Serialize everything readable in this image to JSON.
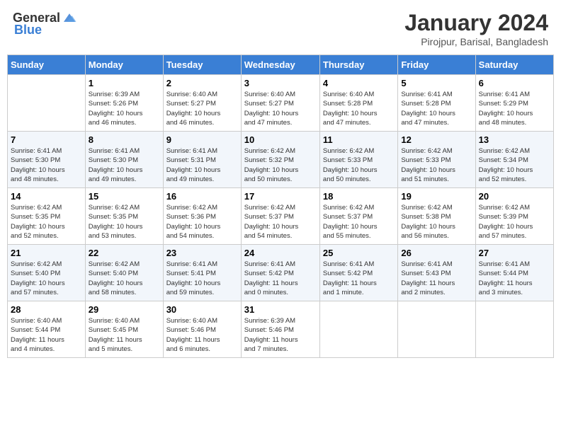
{
  "header": {
    "logo_general": "General",
    "logo_blue": "Blue",
    "month_title": "January 2024",
    "location": "Pirojpur, Barisal, Bangladesh"
  },
  "columns": [
    "Sunday",
    "Monday",
    "Tuesday",
    "Wednesday",
    "Thursday",
    "Friday",
    "Saturday"
  ],
  "weeks": [
    [
      {
        "day": "",
        "info": ""
      },
      {
        "day": "1",
        "info": "Sunrise: 6:39 AM\nSunset: 5:26 PM\nDaylight: 10 hours\nand 46 minutes."
      },
      {
        "day": "2",
        "info": "Sunrise: 6:40 AM\nSunset: 5:27 PM\nDaylight: 10 hours\nand 46 minutes."
      },
      {
        "day": "3",
        "info": "Sunrise: 6:40 AM\nSunset: 5:27 PM\nDaylight: 10 hours\nand 47 minutes."
      },
      {
        "day": "4",
        "info": "Sunrise: 6:40 AM\nSunset: 5:28 PM\nDaylight: 10 hours\nand 47 minutes."
      },
      {
        "day": "5",
        "info": "Sunrise: 6:41 AM\nSunset: 5:28 PM\nDaylight: 10 hours\nand 47 minutes."
      },
      {
        "day": "6",
        "info": "Sunrise: 6:41 AM\nSunset: 5:29 PM\nDaylight: 10 hours\nand 48 minutes."
      }
    ],
    [
      {
        "day": "7",
        "info": "Sunrise: 6:41 AM\nSunset: 5:30 PM\nDaylight: 10 hours\nand 48 minutes."
      },
      {
        "day": "8",
        "info": "Sunrise: 6:41 AM\nSunset: 5:30 PM\nDaylight: 10 hours\nand 49 minutes."
      },
      {
        "day": "9",
        "info": "Sunrise: 6:41 AM\nSunset: 5:31 PM\nDaylight: 10 hours\nand 49 minutes."
      },
      {
        "day": "10",
        "info": "Sunrise: 6:42 AM\nSunset: 5:32 PM\nDaylight: 10 hours\nand 50 minutes."
      },
      {
        "day": "11",
        "info": "Sunrise: 6:42 AM\nSunset: 5:33 PM\nDaylight: 10 hours\nand 50 minutes."
      },
      {
        "day": "12",
        "info": "Sunrise: 6:42 AM\nSunset: 5:33 PM\nDaylight: 10 hours\nand 51 minutes."
      },
      {
        "day": "13",
        "info": "Sunrise: 6:42 AM\nSunset: 5:34 PM\nDaylight: 10 hours\nand 52 minutes."
      }
    ],
    [
      {
        "day": "14",
        "info": "Sunrise: 6:42 AM\nSunset: 5:35 PM\nDaylight: 10 hours\nand 52 minutes."
      },
      {
        "day": "15",
        "info": "Sunrise: 6:42 AM\nSunset: 5:35 PM\nDaylight: 10 hours\nand 53 minutes."
      },
      {
        "day": "16",
        "info": "Sunrise: 6:42 AM\nSunset: 5:36 PM\nDaylight: 10 hours\nand 54 minutes."
      },
      {
        "day": "17",
        "info": "Sunrise: 6:42 AM\nSunset: 5:37 PM\nDaylight: 10 hours\nand 54 minutes."
      },
      {
        "day": "18",
        "info": "Sunrise: 6:42 AM\nSunset: 5:37 PM\nDaylight: 10 hours\nand 55 minutes."
      },
      {
        "day": "19",
        "info": "Sunrise: 6:42 AM\nSunset: 5:38 PM\nDaylight: 10 hours\nand 56 minutes."
      },
      {
        "day": "20",
        "info": "Sunrise: 6:42 AM\nSunset: 5:39 PM\nDaylight: 10 hours\nand 57 minutes."
      }
    ],
    [
      {
        "day": "21",
        "info": "Sunrise: 6:42 AM\nSunset: 5:40 PM\nDaylight: 10 hours\nand 57 minutes."
      },
      {
        "day": "22",
        "info": "Sunrise: 6:42 AM\nSunset: 5:40 PM\nDaylight: 10 hours\nand 58 minutes."
      },
      {
        "day": "23",
        "info": "Sunrise: 6:41 AM\nSunset: 5:41 PM\nDaylight: 10 hours\nand 59 minutes."
      },
      {
        "day": "24",
        "info": "Sunrise: 6:41 AM\nSunset: 5:42 PM\nDaylight: 11 hours\nand 0 minutes."
      },
      {
        "day": "25",
        "info": "Sunrise: 6:41 AM\nSunset: 5:42 PM\nDaylight: 11 hours\nand 1 minute."
      },
      {
        "day": "26",
        "info": "Sunrise: 6:41 AM\nSunset: 5:43 PM\nDaylight: 11 hours\nand 2 minutes."
      },
      {
        "day": "27",
        "info": "Sunrise: 6:41 AM\nSunset: 5:44 PM\nDaylight: 11 hours\nand 3 minutes."
      }
    ],
    [
      {
        "day": "28",
        "info": "Sunrise: 6:40 AM\nSunset: 5:44 PM\nDaylight: 11 hours\nand 4 minutes."
      },
      {
        "day": "29",
        "info": "Sunrise: 6:40 AM\nSunset: 5:45 PM\nDaylight: 11 hours\nand 5 minutes."
      },
      {
        "day": "30",
        "info": "Sunrise: 6:40 AM\nSunset: 5:46 PM\nDaylight: 11 hours\nand 6 minutes."
      },
      {
        "day": "31",
        "info": "Sunrise: 6:39 AM\nSunset: 5:46 PM\nDaylight: 11 hours\nand 7 minutes."
      },
      {
        "day": "",
        "info": ""
      },
      {
        "day": "",
        "info": ""
      },
      {
        "day": "",
        "info": ""
      }
    ]
  ]
}
